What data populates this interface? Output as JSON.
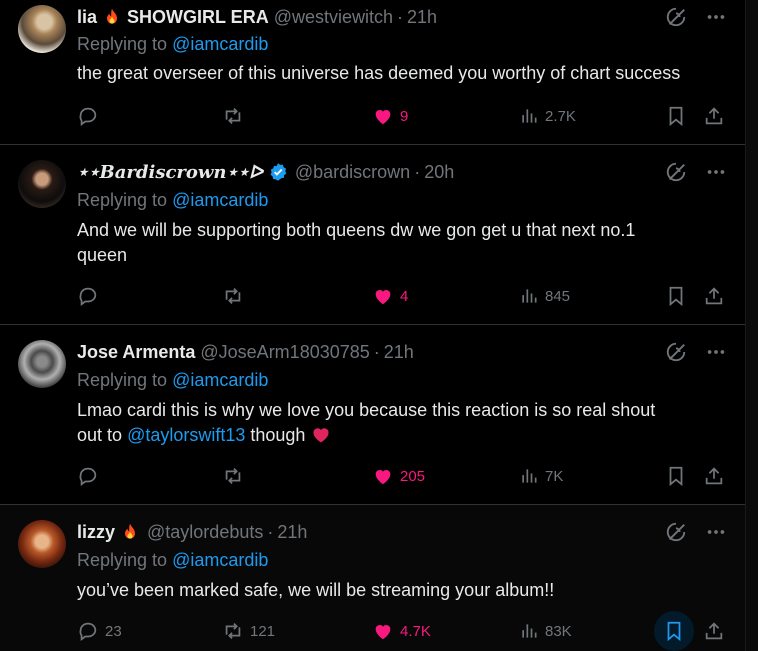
{
  "tweets": [
    {
      "name": "lia",
      "name_suffix": "SHOWGIRL ERA",
      "handle": "@westviewitch",
      "time": "21h",
      "reply_prefix": "Replying to",
      "reply_to": "@iamcardib",
      "text": "the great overseer of this universe has deemed you worthy of chart success",
      "replies": "",
      "reposts": "",
      "likes": "9",
      "views": "2.7K"
    },
    {
      "name": "⋆⋆Bardiscrown⋆⋆ᐅ",
      "handle": "@bardiscrown",
      "time": "20h",
      "reply_prefix": "Replying to",
      "reply_to": "@iamcardib",
      "text_line1": "And we will be supporting both queens dw we gon get u that next no.1",
      "text_line2": "queen",
      "replies": "",
      "reposts": "",
      "likes": "4",
      "views": "845"
    },
    {
      "name": "Jose Armenta",
      "handle": "@JoseArm18030785",
      "time": "21h",
      "reply_prefix": "Replying to",
      "reply_to": "@iamcardib",
      "text_line1": "Lmao cardi this is why we love you because this reaction is so real shout",
      "text_line2_a": "out to",
      "text_line2_mention": "@taylorswift13",
      "text_line2_b": "though",
      "replies": "",
      "reposts": "",
      "likes": "205",
      "views": "7K"
    },
    {
      "name": "lizzy",
      "handle": "@taylordebuts",
      "time": "21h",
      "reply_prefix": "Replying to",
      "reply_to": "@iamcardib",
      "text": "you’ve been marked safe, we will be streaming your album!!",
      "replies": "23",
      "reposts": "121",
      "likes": "4.7K",
      "views": "83K"
    }
  ],
  "separator": "·",
  "colors": {
    "background": "#000000",
    "text": "#e7e9ea",
    "muted": "#71767b",
    "link": "#1d9bf0",
    "like": "#f91880",
    "verified": "#1d9bf0"
  },
  "icons": [
    "grok-icon",
    "more-icon",
    "reply-icon",
    "repost-icon",
    "heart-icon",
    "views-icon",
    "bookmark-icon",
    "share-icon",
    "verified-icon",
    "fire-emoji-icon",
    "heart-emoji-icon"
  ]
}
